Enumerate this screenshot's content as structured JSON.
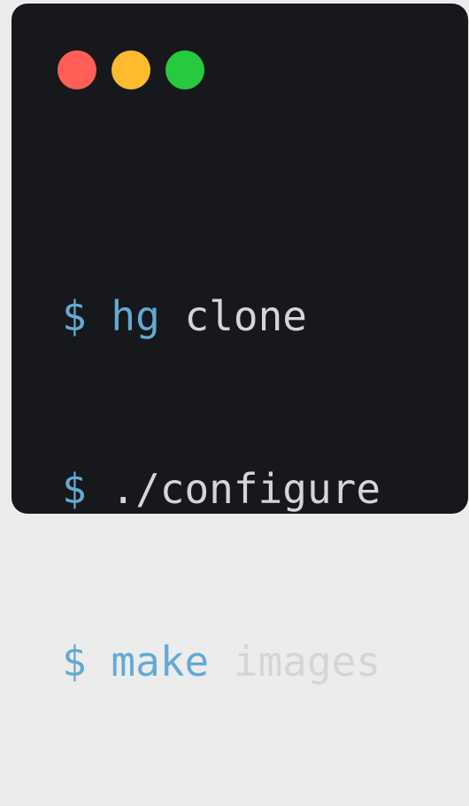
{
  "window_controls": [
    {
      "name": "close",
      "color": "#ff5f56"
    },
    {
      "name": "minimize",
      "color": "#fdbb2d"
    },
    {
      "name": "maximize",
      "color": "#27c93f"
    }
  ],
  "terminal": {
    "lines": [
      {
        "prompt": "$",
        "command": "hg",
        "args": "clone"
      },
      {
        "prompt": "$",
        "command": "",
        "args": "./configure"
      },
      {
        "prompt": "$",
        "command": "make",
        "args": "images"
      }
    ]
  },
  "colors": {
    "background": "#16181b",
    "prompt": "#62aad4",
    "command": "#62aad4",
    "args": "#d3d5d8"
  }
}
